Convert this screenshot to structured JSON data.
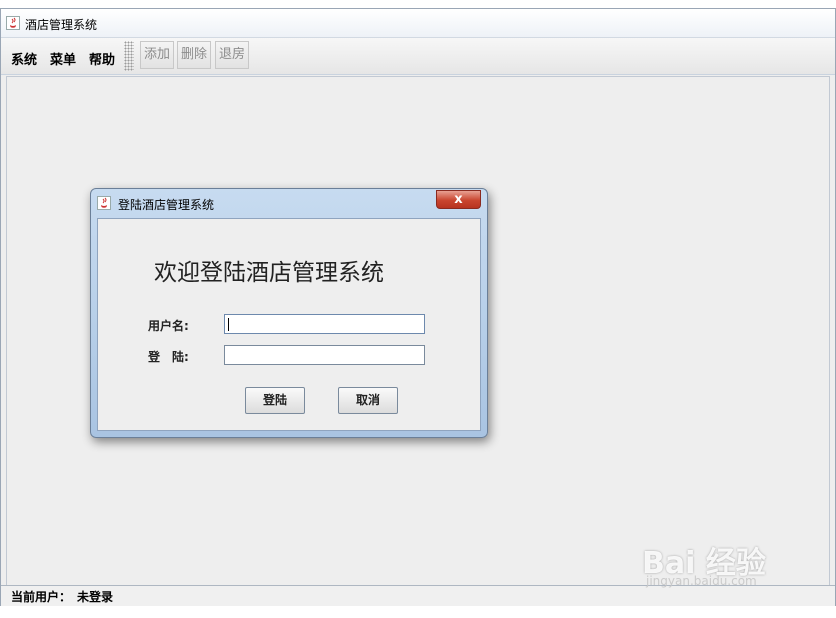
{
  "window": {
    "title": "酒店管理系统",
    "icon": "java-cup-icon"
  },
  "menu": {
    "items": [
      "系统",
      "菜单",
      "帮助"
    ]
  },
  "toolbar": {
    "buttons": [
      "添加",
      "删除",
      "退房"
    ]
  },
  "status": {
    "label": "当前用户：",
    "value": "未登录"
  },
  "dialog": {
    "title": "登陆酒店管理系统",
    "close_label": "x",
    "welcome": "欢迎登陆酒店管理系统",
    "username_label": "用户名:",
    "username_value": "",
    "password_label": "登　陆:",
    "password_value": "",
    "login_button": "登陆",
    "cancel_button": "取消"
  },
  "watermark": {
    "main": "Bai 经验",
    "sub": "jingyan.baidu.com"
  },
  "colors": {
    "dialog_frame": "#a9c4e2",
    "close_button": "#c9452f",
    "window_bg": "#eeeeee"
  }
}
